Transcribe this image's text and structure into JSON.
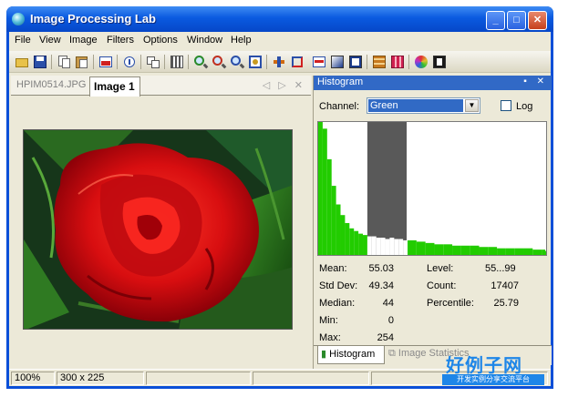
{
  "window": {
    "title": "Image Processing Lab",
    "minimize_label": "_",
    "maximize_label": "□",
    "close_label": "✕"
  },
  "menu": {
    "items": [
      "File",
      "View",
      "Image",
      "Filters",
      "Options",
      "Window",
      "Help"
    ]
  },
  "toolbar": {
    "icons": [
      "open-icon",
      "save-icon",
      "copy-icon",
      "paste-icon",
      "image-icon",
      "info-icon",
      "clone-icon",
      "fit-icon",
      "zoom-in-icon",
      "zoom-out-icon",
      "zoom-normal-icon",
      "zoom-fit-icon",
      "move-icon",
      "crop-icon",
      "histogram-view-icon",
      "gradient-icon",
      "levels-icon",
      "grid-icon",
      "grid2-icon",
      "color-wheel-icon",
      "fullscreen-icon"
    ]
  },
  "documents": {
    "tabs": [
      {
        "label": "HPIM0514.JPG",
        "active": false
      },
      {
        "label": "Image 1",
        "active": true
      }
    ],
    "nav_label": "◁ ▷ ✕"
  },
  "histogram_panel": {
    "title": "Histogram",
    "controls_label": "▪ ✕",
    "channel_label": "Channel:",
    "channel_value": "Green",
    "log_label": "Log",
    "log_checked": false,
    "stats": {
      "mean_label": "Mean:",
      "mean_value": "55.03",
      "stddev_label": "Std Dev:",
      "stddev_value": "49.34",
      "median_label": "Median:",
      "median_value": "44",
      "min_label": "Min:",
      "min_value": "0",
      "max_label": "Max:",
      "max_value": "254",
      "level_label": "Level:",
      "level_value": "55...99",
      "count_label": "Count:",
      "count_value": "17407",
      "percentile_label": "Percentile:",
      "percentile_value": "25.79"
    },
    "tabs": [
      {
        "label": "Histogram",
        "active": true
      },
      {
        "label": "Image Statistics",
        "active": false
      }
    ],
    "colors": {
      "bars": "#22cc00",
      "selection": "#595959"
    }
  },
  "chart_data": {
    "type": "bar",
    "x": [
      0,
      5,
      10,
      15,
      20,
      25,
      30,
      35,
      40,
      45,
      50,
      55,
      60,
      65,
      70,
      75,
      80,
      85,
      90,
      95,
      100,
      110,
      120,
      130,
      140,
      150,
      160,
      170,
      180,
      190,
      200,
      210,
      220,
      230,
      240,
      250,
      254
    ],
    "values": [
      1.0,
      0.95,
      0.72,
      0.52,
      0.38,
      0.3,
      0.24,
      0.2,
      0.18,
      0.16,
      0.15,
      0.14,
      0.14,
      0.13,
      0.13,
      0.12,
      0.13,
      0.12,
      0.12,
      0.11,
      0.11,
      0.1,
      0.09,
      0.08,
      0.08,
      0.07,
      0.07,
      0.07,
      0.06,
      0.06,
      0.05,
      0.05,
      0.05,
      0.05,
      0.04,
      0.04,
      0.03
    ],
    "selection": [
      55,
      99
    ],
    "xlim": [
      0,
      255
    ],
    "ylim": [
      0,
      1
    ]
  },
  "statusbar": {
    "zoom": "100%",
    "size": "300 x 225"
  },
  "watermark": {
    "logo": "好例子网",
    "sub": "开发实例分享交流平台"
  }
}
